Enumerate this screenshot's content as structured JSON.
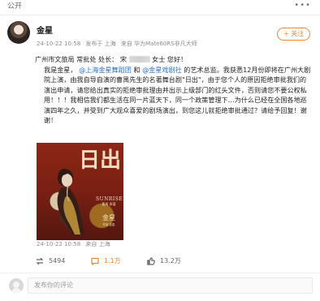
{
  "top": {
    "label": "公开",
    "more": "•••"
  },
  "post": {
    "author": "金星",
    "meta": {
      "time": "24-10-22 10:58",
      "source": "发布于 上海",
      "device": "来自 华为Mate60RS非凡大师"
    },
    "follow_label": "+ 关注",
    "lines": {
      "line1": "广州市文旅局 常批处 处长：",
      "line1_2": "宋",
      "line1_3": "女士 您好！",
      "line2_a": "我是金星，",
      "line2_m1": "@上海金星舞蹈团",
      "line2_b": " 和 ",
      "line2_m2": "@金星戏剧社",
      "line2_c": " 的艺术总监。我获悉12月份即将在广州大剧院上演，由我自导自演的曹禺先生的名著舞台剧\"日出\"，由于您个人的原因拒绝审批我们的演出申请，请您给出真实的拒绝审批理由并出示上级部门的红头文件，否则请您不要公权私用！！！我相信我们都生活在同一片蓝天下，同一个政策管理下…为什么已经在全国各地巡演四年之久，并受到广大观众喜爱的剧场演出，到您这儿就拒绝审批通过？请给予回复！谢谢！"
    },
    "poster": {
      "title": "日出",
      "english": "SUNRISE",
      "subtitle": "曹禺 原著",
      "name": "金星",
      "credit": "导演 金星"
    },
    "footer": {
      "time": "24-10-22 10:58",
      "source": "来自 上海"
    },
    "actions": {
      "repost": "5494",
      "comments": "1.1万",
      "likes": "13.2万"
    }
  },
  "comment": {
    "placeholder": "发布你的评论"
  }
}
